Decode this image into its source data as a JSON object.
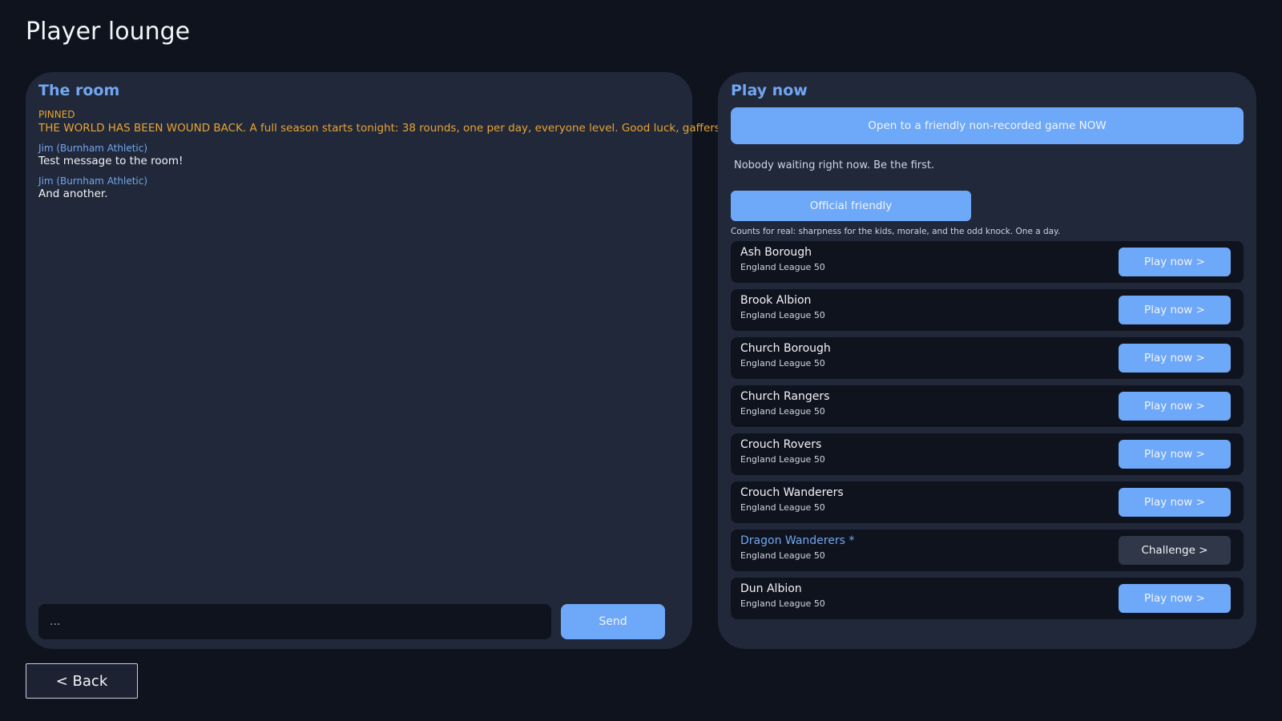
{
  "page": {
    "title": "Player lounge"
  },
  "room": {
    "title": "The room",
    "pinned_label": "PINNED",
    "pinned_text": "THE WORLD HAS BEEN WOUND BACK. A full season starts tonight: 38 rounds, one per day, everyone level. Good luck, gaffers.",
    "messages": [
      {
        "author": "Jim (Burnham Athletic)",
        "text": "Test message to the room!"
      },
      {
        "author": "Jim (Burnham Athletic)",
        "text": "And another."
      }
    ],
    "composer_value": "...",
    "send_label": "Send"
  },
  "play": {
    "title": "Play now",
    "open_label": "Open to a friendly non-recorded game NOW",
    "waiting_text": "Nobody waiting right now. Be the first.",
    "official_label": "Official friendly",
    "official_note": "Counts for real: sharpness for the kids, morale, and the odd knock. One a day.",
    "clubs": [
      {
        "name": "Ash Borough",
        "league": "England League 50",
        "action": "Play now >"
      },
      {
        "name": "Brook Albion",
        "league": "England League 50",
        "action": "Play now >"
      },
      {
        "name": "Church Borough",
        "league": "England League 50",
        "action": "Play now >"
      },
      {
        "name": "Church Rangers",
        "league": "England League 50",
        "action": "Play now >"
      },
      {
        "name": "Crouch Rovers",
        "league": "England League 50",
        "action": "Play now >"
      },
      {
        "name": "Crouch Wanderers",
        "league": "England League 50",
        "action": "Play now >"
      },
      {
        "name": "Dragon Wanderers *",
        "league": "England League 50",
        "action": "Challenge >"
      },
      {
        "name": "Dun Albion",
        "league": "England League 50",
        "action": "Play now >"
      }
    ]
  },
  "back_label": "< Back",
  "colors": {
    "accent": "#6ea8f8",
    "pinned": "#e8a436",
    "background": "#0f131d",
    "panel": "#212839"
  }
}
